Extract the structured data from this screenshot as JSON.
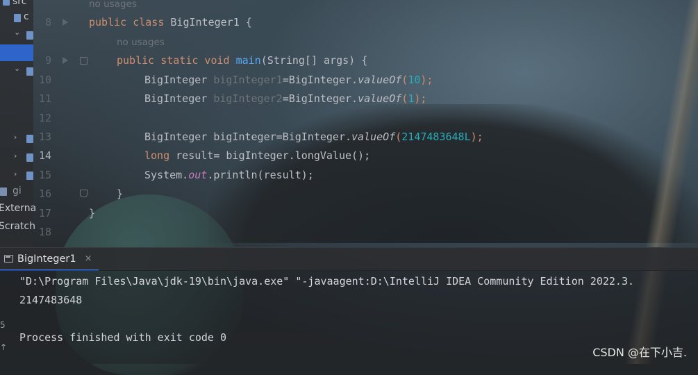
{
  "sidebar": {
    "items": [
      {
        "label": "src"
      },
      {
        "label": "gi"
      },
      {
        "label": "Externa"
      },
      {
        "label": "Scratch"
      }
    ]
  },
  "editor": {
    "line_numbers": [
      "8",
      "9",
      "10",
      "11",
      "12",
      "13",
      "14",
      "15",
      "16",
      "17",
      "18"
    ],
    "usage_hints": [
      "no usages",
      "no usages"
    ],
    "lines": {
      "l8": {
        "kw": "public class ",
        "name": "BigInteger1",
        "rest": " {"
      },
      "l9": {
        "kw": "public static void ",
        "fn": "main",
        "rest": "(String[] args) {"
      },
      "l10": {
        "type": "BigInteger ",
        "var": "bigInteger1",
        "a": "=BigInteger.",
        "m": "valueOf",
        "b": "(",
        "num": "10",
        "c": ");"
      },
      "l11": {
        "type": "BigInteger ",
        "var": "bigInteger2",
        "a": "=BigInteger.",
        "m": "valueOf",
        "b": "(",
        "num": "1",
        "c": ");"
      },
      "l13": {
        "type": "BigInteger ",
        "var": "bigInteger",
        "a": "=BigInteger.",
        "m": "valueOf",
        "b": "(",
        "num": "2147483648L",
        "c": ");"
      },
      "l14": {
        "kw": "long ",
        "rest": "result= bigInteger.longValue();"
      },
      "l15": {
        "a": "System.",
        "out": "out",
        "b": ".println(result);"
      },
      "l16": {
        "rest": "}"
      },
      "l17": {
        "rest": "}"
      }
    }
  },
  "run_panel": {
    "tab_label": "BigInteger1",
    "close_glyph": "×",
    "console": [
      "\"D:\\Program Files\\Java\\jdk-19\\bin\\java.exe\" \"-javaagent:D:\\IntelliJ IDEA Community Edition 2022.3.",
      "2147483648",
      "",
      "Process finished with exit code 0"
    ],
    "left_glyphs": [
      "5",
      "↑"
    ]
  },
  "watermark": "CSDN @在下小吉.",
  "colors": {
    "keyword": "#cf8e6d",
    "method": "#56a8f5",
    "number": "#2aacb8",
    "text": "#bcbec4",
    "hint": "#6f737a",
    "selection": "#2f65ca"
  },
  "icons": [
    "folder-icon",
    "module-icon",
    "chevron-right-icon",
    "chevron-down-icon",
    "run-gutter-icon",
    "fold-icon",
    "console-tab-icon",
    "close-icon"
  ]
}
